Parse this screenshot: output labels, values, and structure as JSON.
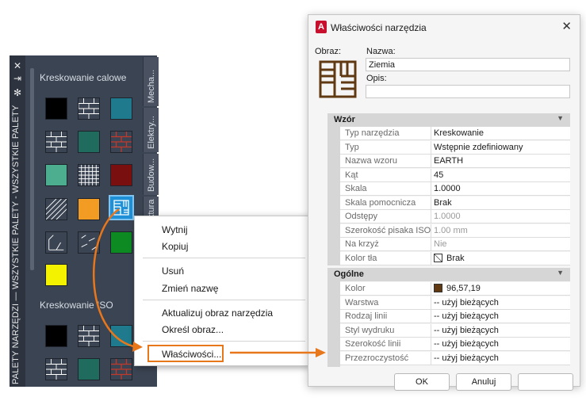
{
  "palette": {
    "strip_title": "PALETY NARZĘDZI — WSZYSTKIE PALETY - WSZYSTKIE PALETY",
    "section1_title": "Kreskowanie calowe",
    "section2_title": "Kreskowanie ISO",
    "tabs": [
      "Mecha...",
      "Elektry...",
      "Budow...",
      "ktura"
    ],
    "icons": {
      "close": "close-icon",
      "autohide": "autohide-icon",
      "settings": "gear-icon"
    }
  },
  "context_menu": {
    "items": [
      "Wytnij",
      "Kopiuj",
      "Usuń",
      "Zmień nazwę",
      "Aktualizuj obraz narzędzia",
      "Określ obraz...",
      "Właściwości..."
    ]
  },
  "dialog": {
    "title": "Właściwości narzędzia",
    "image_label": "Obraz:",
    "name_label": "Nazwa:",
    "name_value": "Ziemia",
    "desc_label": "Opis:",
    "desc_value": "",
    "pattern_group": "Wzór",
    "pattern_rows": [
      {
        "key": "Typ narzędzia",
        "value": "Kreskowanie",
        "dim": false
      },
      {
        "key": "Typ",
        "value": "Wstępnie zdefiniowany",
        "dim": false
      },
      {
        "key": "Nazwa wzoru",
        "value": "EARTH",
        "dim": false
      },
      {
        "key": "Kąt",
        "value": "45",
        "dim": false
      },
      {
        "key": "Skala",
        "value": "1.0000",
        "dim": false
      },
      {
        "key": "Skala pomocnicza",
        "value": "Brak",
        "dim": false
      },
      {
        "key": "Odstępy",
        "value": "1.0000",
        "dim": true
      },
      {
        "key": "Szerokość pisaka ISO",
        "value": "1.00 mm",
        "dim": true
      },
      {
        "key": "Na krzyż",
        "value": "Nie",
        "dim": true
      },
      {
        "key": "Kolor tła",
        "value": "Brak",
        "dim": false
      }
    ],
    "general_group": "Ogólne",
    "general_rows": [
      {
        "key": "Kolor",
        "value": "96,57,19"
      },
      {
        "key": "Warstwa",
        "value": "-- użyj bieżących"
      },
      {
        "key": "Rodzaj linii",
        "value": "-- użyj bieżących"
      },
      {
        "key": "Styl wydruku",
        "value": "-- użyj bieżących"
      },
      {
        "key": "Szerokość linii",
        "value": "-- użyj bieżących"
      },
      {
        "key": "Przezroczystość",
        "value": "-- użyj bieżących"
      }
    ],
    "ok_label": "OK",
    "cancel_label": "Anuluj",
    "colors": {
      "earth": "#603913",
      "accent": "#e8771b",
      "selected": "#1e90d8"
    }
  }
}
